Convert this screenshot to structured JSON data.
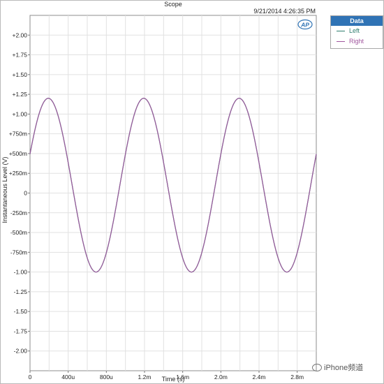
{
  "chart_data": {
    "type": "line",
    "title": "Scope",
    "timestamp": "9/21/2014 4:26:35 PM",
    "xlabel": "Time (s)",
    "ylabel": "Instantaneous Level (V)",
    "xlim": [
      0,
      0.003
    ],
    "ylim": [
      -2.25,
      2.25
    ],
    "x_ticks": [
      0,
      0.0004,
      0.0008,
      0.0012,
      0.0016,
      0.002,
      0.0024,
      0.0028
    ],
    "x_tick_labels": [
      "0",
      "400u",
      "800u",
      "1.2m",
      "1.6m",
      "2.0m",
      "2.4m",
      "2.8m"
    ],
    "y_ticks": [
      2.0,
      1.75,
      1.5,
      1.25,
      1.0,
      0.75,
      0.5,
      0.25,
      0,
      -0.25,
      -0.5,
      -0.75,
      -1.0,
      -1.25,
      -1.5,
      -1.75,
      -2.0
    ],
    "y_tick_labels": [
      "+2.00",
      "+1.75",
      "+1.50",
      "+1.25",
      "+1.00",
      "+750m",
      "+500m",
      "+250m",
      "0",
      "-250m",
      "-500m",
      "-750m",
      "-1.00",
      "-1.25",
      "-1.50",
      "-1.75",
      "-2.00"
    ],
    "grid": true,
    "legend_position": "top-right",
    "signal": {
      "frequency_hz": 1000,
      "peak_v": 1.2,
      "clip_low_v": -1.0,
      "offset_v": 0.1,
      "phase_deg": 21,
      "clip_ripple_v": 0.02
    },
    "series": [
      {
        "name": "Left",
        "color": "#2e7d6e"
      },
      {
        "name": "Right",
        "color": "#a0569e"
      }
    ]
  },
  "legend": {
    "title": "Data",
    "items": [
      "Left",
      "Right"
    ]
  },
  "logo": "AP",
  "watermark": "iPhone频道"
}
